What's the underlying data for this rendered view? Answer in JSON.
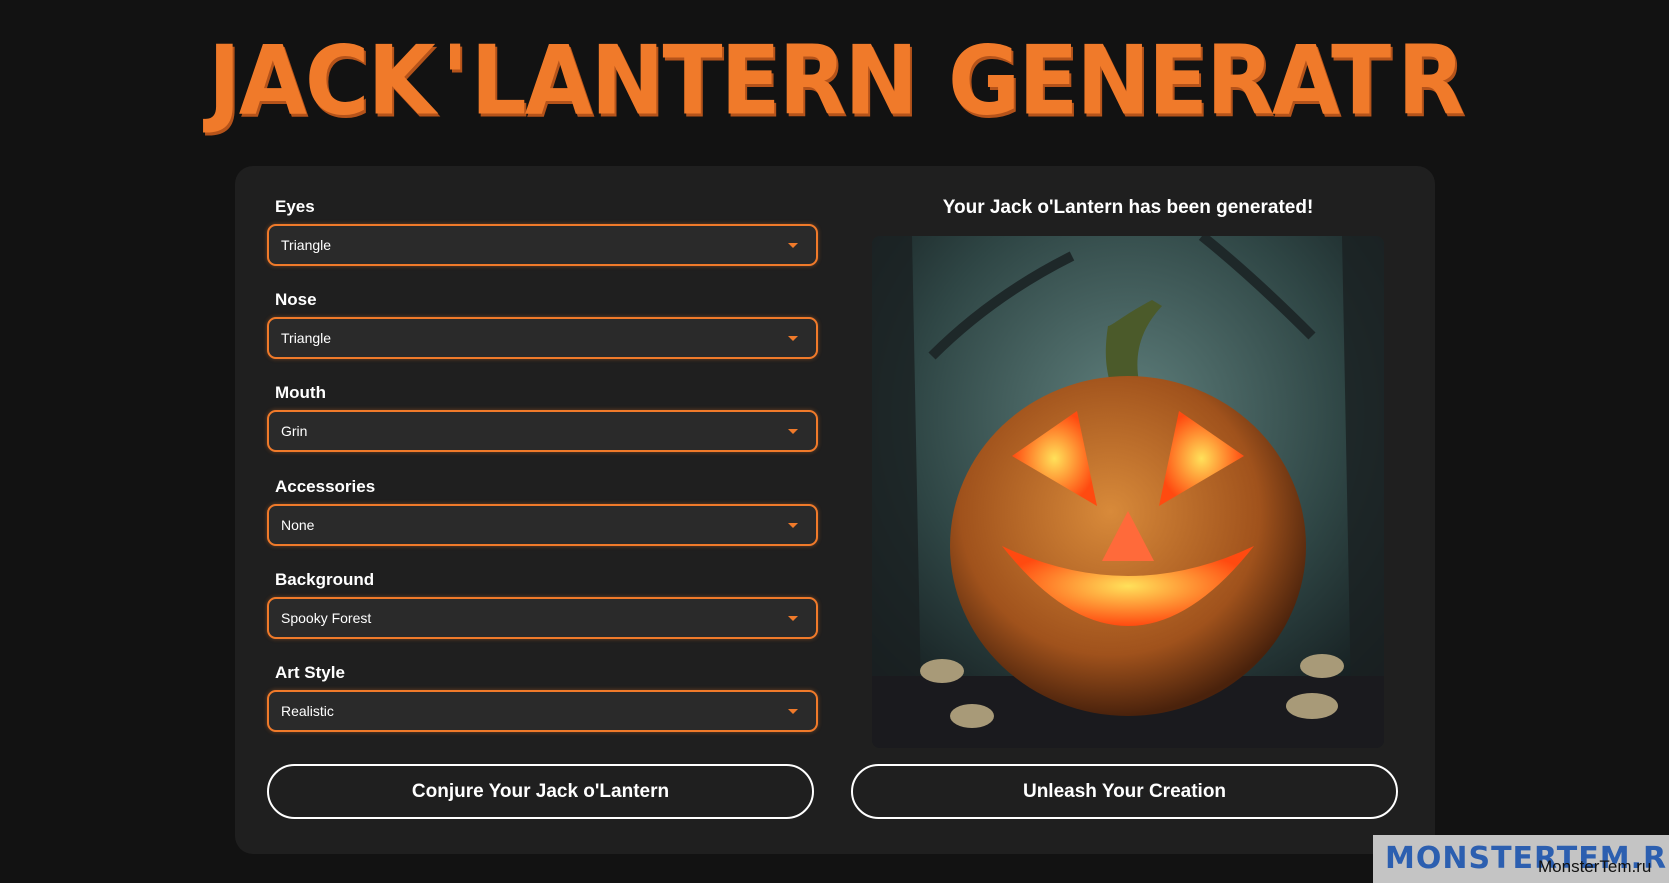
{
  "title": {
    "part1": "JACK",
    "part2": "'",
    "part3": "LANTERN",
    "part4": "GENERAT",
    "part5": "R"
  },
  "form": {
    "fields": [
      {
        "label": "Eyes",
        "value": "Triangle"
      },
      {
        "label": "Nose",
        "value": "Triangle"
      },
      {
        "label": "Mouth",
        "value": "Grin"
      },
      {
        "label": "Accessories",
        "value": "None"
      },
      {
        "label": "Background",
        "value": "Spooky Forest"
      },
      {
        "label": "Art Style",
        "value": "Realistic"
      }
    ],
    "generate_label": "Conjure Your Jack o'Lantern"
  },
  "result": {
    "heading": "Your Jack o'Lantern has been generated!",
    "download_label": "Unleash Your Creation"
  },
  "watermark": {
    "logo": "MONSTERTEM.RU",
    "text": "MonsterTem.ru"
  },
  "colors": {
    "accent": "#f07a2a",
    "background": "#121212",
    "panel": "#1f1f1f"
  }
}
